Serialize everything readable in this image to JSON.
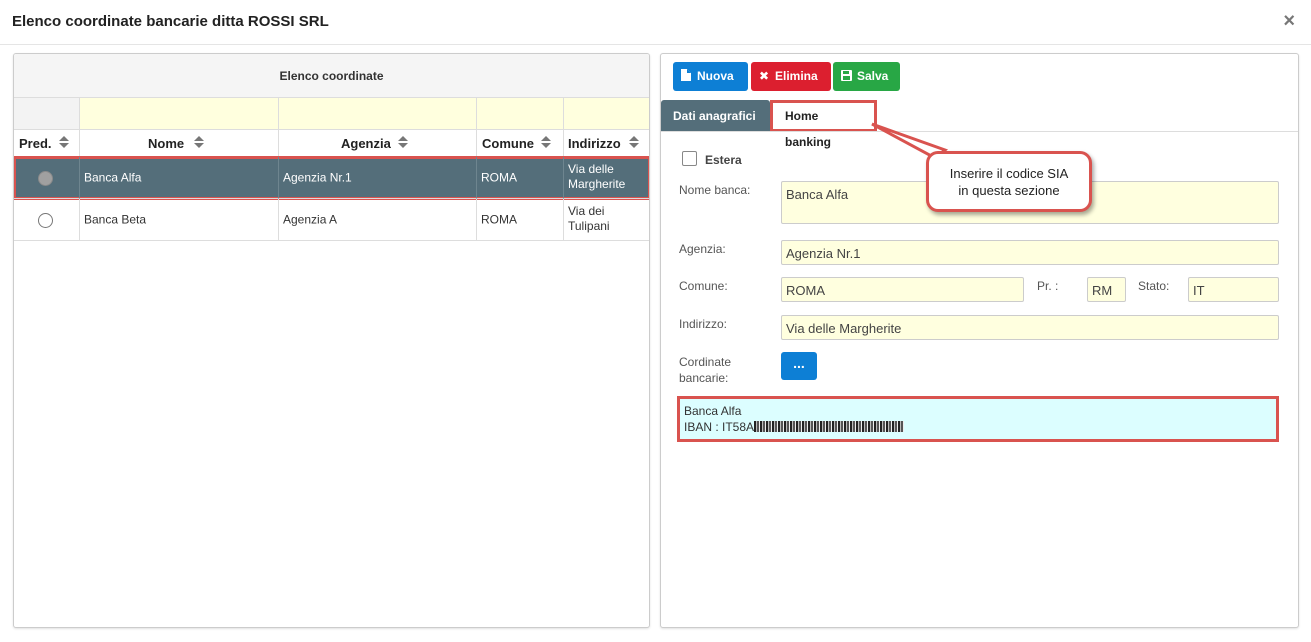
{
  "dialog": {
    "title": "Elenco coordinate bancarie ditta ROSSI SRL",
    "close_glyph": "×"
  },
  "list": {
    "heading": "Elenco coordinate",
    "columns": [
      "Pred.",
      "Nome",
      "Agenzia",
      "Comune",
      "Indirizzo"
    ],
    "rows": [
      {
        "nome": "Banca Alfa",
        "agenzia": "Agenzia Nr.1",
        "comune": "ROMA",
        "indirizzo_1": "Via delle",
        "indirizzo_2": "Margherite",
        "predefinito": true,
        "selected": true
      },
      {
        "nome": "Banca Beta",
        "agenzia": "Agenzia A",
        "comune": "ROMA",
        "indirizzo_1": "Via dei",
        "indirizzo_2": "Tulipani",
        "predefinito": false,
        "selected": false
      }
    ]
  },
  "toolbar": {
    "nuova": "Nuova",
    "elimina": "Elimina",
    "salva": "Salva"
  },
  "tabs": {
    "dati": "Dati anagrafici",
    "home": "Home banking"
  },
  "form": {
    "estera_label": "Estera",
    "nome_label": "Nome banca:",
    "nome_value": "Banca Alfa",
    "agenzia_label": "Agenzia:",
    "agenzia_value": "Agenzia Nr.1",
    "comune_label": "Comune:",
    "comune_value": "ROMA",
    "pr_label": "Pr. :",
    "pr_value": "RM",
    "stato_label": "Stato:",
    "stato_value": "IT",
    "indirizzo_label": "Indirizzo:",
    "indirizzo_value": "Via delle Margherite",
    "cordinate_label_1": "Cordinate",
    "cordinate_label_2": "bancarie:",
    "dots_button": "...",
    "summary_line1": "Banca Alfa",
    "summary_line2": "IBAN : IT58A"
  },
  "callout": {
    "line1": "Inserire il codice SIA",
    "line2": "in questa sezione"
  },
  "colors": {
    "selected_row": "#546e7a",
    "highlight": "#d9534f",
    "field_bg": "#ffffdf",
    "summary_bg": "#dcfeff"
  }
}
